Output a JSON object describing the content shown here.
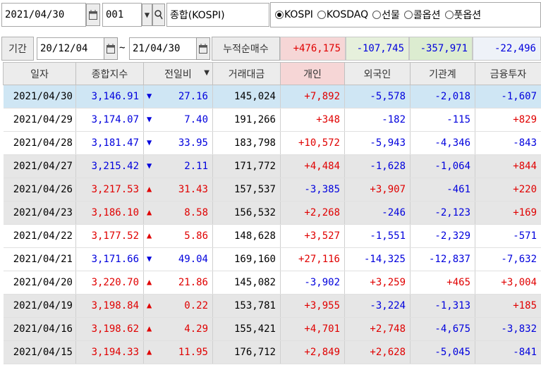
{
  "topbar": {
    "date": "2021/04/30",
    "code": "001",
    "index_name": "종합(KOSPI)",
    "markets": [
      {
        "label": "KOSPI",
        "selected": true
      },
      {
        "label": "KOSDAQ",
        "selected": false
      },
      {
        "label": "선물",
        "selected": false
      },
      {
        "label": "콜옵션",
        "selected": false
      },
      {
        "label": "풋옵션",
        "selected": false
      }
    ]
  },
  "period": {
    "label": "기간",
    "start": "20/12/04",
    "tilde": "~",
    "end": "21/04/30",
    "net_label": "누적순매수",
    "net_individual": "+476,175",
    "net_foreign": "-107,745",
    "net_institution": "-357,971",
    "net_finance": "-22,496"
  },
  "table": {
    "headers": {
      "date": "일자",
      "index": "종합지수",
      "change": "전일비",
      "volume": "거래대금",
      "individual": "개인",
      "foreign": "외국인",
      "institution": "기관계",
      "finance": "금융투자"
    },
    "rows": [
      {
        "date": "2021/04/30",
        "index": "3,146.91",
        "dir": "down",
        "change": "27.16",
        "volume": "145,024",
        "individual": "+7,892",
        "foreign": "-5,578",
        "institution": "-2,018",
        "finance": "-1,607"
      },
      {
        "date": "2021/04/29",
        "index": "3,174.07",
        "dir": "down",
        "change": "7.40",
        "volume": "191,266",
        "individual": "+348",
        "foreign": "-182",
        "institution": "-115",
        "finance": "+829"
      },
      {
        "date": "2021/04/28",
        "index": "3,181.47",
        "dir": "down",
        "change": "33.95",
        "volume": "183,798",
        "individual": "+10,572",
        "foreign": "-5,943",
        "institution": "-4,346",
        "finance": "-843"
      },
      {
        "date": "2021/04/27",
        "index": "3,215.42",
        "dir": "down",
        "change": "2.11",
        "volume": "171,772",
        "individual": "+4,484",
        "foreign": "-1,628",
        "institution": "-1,064",
        "finance": "+844"
      },
      {
        "date": "2021/04/26",
        "index": "3,217.53",
        "dir": "up",
        "change": "31.43",
        "volume": "157,537",
        "individual": "-3,385",
        "foreign": "+3,907",
        "institution": "-461",
        "finance": "+220"
      },
      {
        "date": "2021/04/23",
        "index": "3,186.10",
        "dir": "up",
        "change": "8.58",
        "volume": "156,532",
        "individual": "+2,268",
        "foreign": "-246",
        "institution": "-2,123",
        "finance": "+169"
      },
      {
        "date": "2021/04/22",
        "index": "3,177.52",
        "dir": "up",
        "change": "5.86",
        "volume": "148,628",
        "individual": "+3,527",
        "foreign": "-1,551",
        "institution": "-2,329",
        "finance": "-571"
      },
      {
        "date": "2021/04/21",
        "index": "3,171.66",
        "dir": "down",
        "change": "49.04",
        "volume": "169,160",
        "individual": "+27,116",
        "foreign": "-14,325",
        "institution": "-12,837",
        "finance": "-7,632"
      },
      {
        "date": "2021/04/20",
        "index": "3,220.70",
        "dir": "up",
        "change": "21.86",
        "volume": "145,082",
        "individual": "-3,902",
        "foreign": "+3,259",
        "institution": "+465",
        "finance": "+3,004"
      },
      {
        "date": "2021/04/19",
        "index": "3,198.84",
        "dir": "up",
        "change": "0.22",
        "volume": "153,781",
        "individual": "+3,955",
        "foreign": "-3,224",
        "institution": "-1,313",
        "finance": "+185"
      },
      {
        "date": "2021/04/16",
        "index": "3,198.62",
        "dir": "up",
        "change": "4.29",
        "volume": "155,421",
        "individual": "+4,701",
        "foreign": "+2,748",
        "institution": "-4,675",
        "finance": "-3,832"
      },
      {
        "date": "2021/04/15",
        "index": "3,194.33",
        "dir": "up",
        "change": "11.95",
        "volume": "176,712",
        "individual": "+2,849",
        "foreign": "+2,628",
        "institution": "-5,045",
        "finance": "-841"
      }
    ]
  },
  "colors": {
    "up": "#e00000",
    "down": "#0000dd",
    "selected_row": "#cfe6f4",
    "gray_row": "#e6e6e6",
    "individual_header": "#f6d6d6"
  }
}
